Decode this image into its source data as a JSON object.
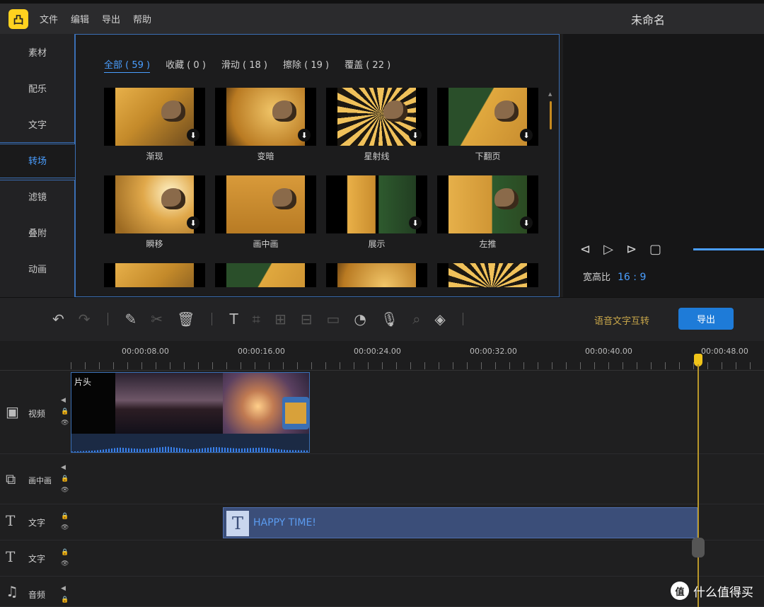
{
  "app": {
    "logo_text": "凸",
    "title": "未命名"
  },
  "menu": [
    "文件",
    "编辑",
    "导出",
    "帮助"
  ],
  "sidebar": {
    "items": [
      "素材",
      "配乐",
      "文字",
      "转场",
      "滤镜",
      "叠附",
      "动画"
    ],
    "active": "转场"
  },
  "library": {
    "tabs": [
      "全部 ( 59 )",
      "收藏 ( 0 )",
      "滑动 ( 18 )",
      "擦除 ( 19 )",
      "覆盖 ( 22 )"
    ],
    "active_tab": "全部 ( 59 )",
    "items": [
      "渐现",
      "变暗",
      "星射线",
      "下翻页",
      "瞬移",
      "画中画",
      "展示",
      "左推"
    ]
  },
  "preview": {
    "aspect_label": "宽高比",
    "aspect_value": "16 : 9"
  },
  "toolbar": {
    "speech_text": "语音文字互转",
    "export_label": "导出"
  },
  "timeline": {
    "ruler": [
      "00:00:08.00",
      "00:00:16.00",
      "00:00:24.00",
      "00:00:32.00",
      "00:00:40.00",
      "00:00:48.00"
    ],
    "tracks": [
      "视频",
      "画中画",
      "文字",
      "文字",
      "音频"
    ],
    "video_clip_text": "片头",
    "text_clip": "HAPPY TIME!"
  },
  "watermark": {
    "icon": "值",
    "text": "什么值得买"
  },
  "colors": {
    "accent": "#4a9eff",
    "export_button": "#1e7bd8",
    "playhead": "#f0c419",
    "text_clip": "#3b4e79"
  }
}
